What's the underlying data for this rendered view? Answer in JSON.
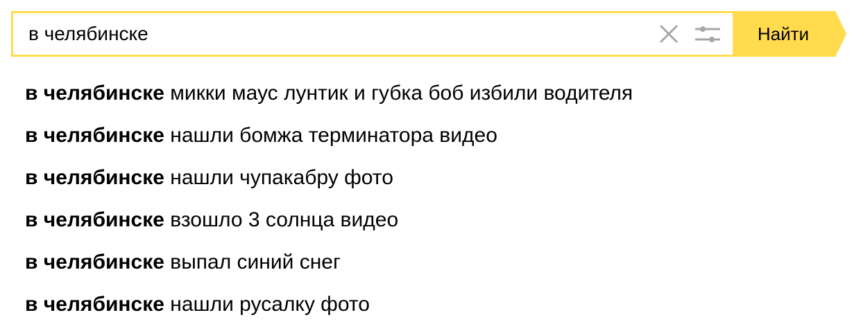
{
  "search": {
    "value": "в челябинске",
    "submit_label": "Найти"
  },
  "icons": {
    "clear": "close-icon",
    "filter": "sliders-icon"
  },
  "colors": {
    "accent": "#ffdb4d",
    "icon": "#a6a6a6"
  },
  "suggestions": [
    {
      "prefix": "в челябинске",
      "rest": "микки маус лунтик и губка боб избили водителя"
    },
    {
      "prefix": "в челябинске",
      "rest": "нашли бомжа терминатора видео"
    },
    {
      "prefix": "в челябинске",
      "rest": "нашли чупакабру фото"
    },
    {
      "prefix": "в челябинске",
      "rest": "взошло 3 солнца видео"
    },
    {
      "prefix": "в челябинске",
      "rest": "выпал синий снег"
    },
    {
      "prefix": "в челябинске",
      "rest": "нашли русалку фото"
    }
  ]
}
